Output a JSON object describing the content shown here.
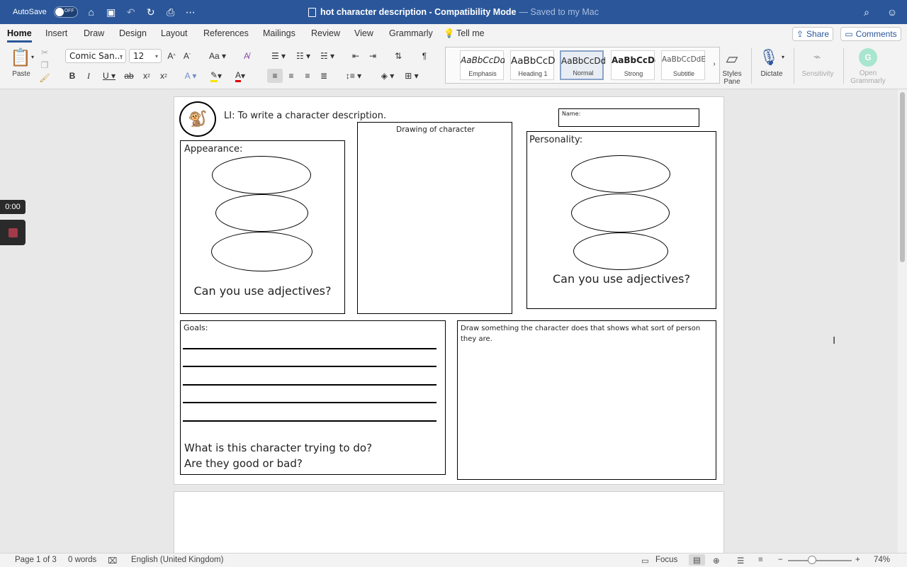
{
  "titlebar": {
    "autosave_label": "AutoSave",
    "autosave_state": "OFF",
    "doc_title": "hot character description",
    "mode": "Compatibility Mode",
    "saved_status": "— Saved to my Mac"
  },
  "tabs": [
    "Home",
    "Insert",
    "Draw",
    "Design",
    "Layout",
    "References",
    "Mailings",
    "Review",
    "View",
    "Grammarly",
    "Tell me"
  ],
  "buttons": {
    "share": "Share",
    "comments": "Comments"
  },
  "ribbon": {
    "paste_label": "Paste",
    "font_name": "Comic San...",
    "font_size": "12",
    "styles": [
      {
        "preview": "AaBbCcDdE",
        "label": "Emphasis"
      },
      {
        "preview": "AaBbCcD",
        "label": "Heading 1"
      },
      {
        "preview": "AaBbCcDdE",
        "label": "Normal"
      },
      {
        "preview": "AaBbCcDd",
        "label": "Strong"
      },
      {
        "preview": "AaBbCcDdEe",
        "label": "Subtitle"
      }
    ],
    "styles_pane_label": "Styles Pane",
    "dictate_label": "Dictate",
    "sensitivity_label": "Sensitivity",
    "grammarly_label": "Open Grammarly"
  },
  "document": {
    "li_text": "LI: To write a character description.",
    "name_label": "Name:",
    "drawing_label": "Drawing of character",
    "appearance_label": "Appearance:",
    "personality_label": "Personality:",
    "adjectives_prompt": "Can you use adjectives?",
    "goals_label": "Goals:",
    "draw_prompt": "Draw something the character does that shows what sort of person they are.",
    "question_1": "What is this character trying to do?",
    "question_2": "Are they good or bad?"
  },
  "timer": {
    "time": "0:00"
  },
  "statusbar": {
    "page": "Page 1 of 3",
    "words": "0 words",
    "language": "English (United Kingdom)",
    "focus": "Focus",
    "zoom": "74%"
  },
  "colors": {
    "title_bar": "#2b579a",
    "accent": "#2b579a"
  }
}
